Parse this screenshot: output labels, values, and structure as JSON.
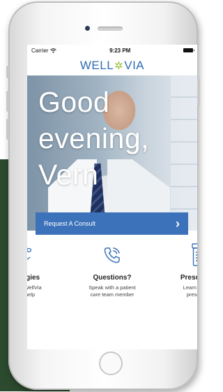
{
  "status": {
    "carrier": "Carrier",
    "time": "9:23 PM"
  },
  "logo": {
    "left": "WELL",
    "right": "VIA"
  },
  "hero": {
    "greeting_line1": "Good",
    "greeting_line2": "evening,",
    "greeting_line3": "Vern"
  },
  "consult_button": {
    "label": "Request A Consult",
    "chevron": "›"
  },
  "cards": [
    {
      "title": "Allergies",
      "description": "n how WellVia\ncan help",
      "icon": "flower-icon"
    },
    {
      "title": "Questions?",
      "description": "Speak with a patient\ncare team member",
      "icon": "phone-icon"
    },
    {
      "title": "Prescriptio",
      "description": "Learn more a\nprescriptio",
      "icon": "pill-bottle-icon"
    }
  ],
  "colors": {
    "brand_blue": "#3b72b9",
    "logo_green": "#9bbf3a",
    "background_green": "#2c4a2e"
  }
}
